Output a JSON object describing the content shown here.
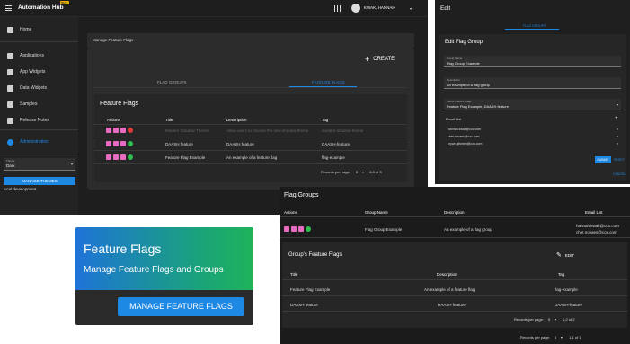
{
  "app": {
    "title": "Automation Hub",
    "beta_badge": "BETA",
    "user_name": "KWAK, HANNAH",
    "sidebar": [
      {
        "label": "Home",
        "icon": "home-icon"
      },
      {
        "label": "Applications",
        "icon": "apps-icon"
      },
      {
        "label": "App Widgets",
        "icon": "widgets-icon"
      },
      {
        "label": "Data Widgets",
        "icon": "data-icon"
      },
      {
        "label": "Samples",
        "icon": "samples-icon"
      },
      {
        "label": "Release Notes",
        "icon": "notes-icon"
      },
      {
        "label": "Administration",
        "icon": "admin-icon"
      }
    ],
    "theme_label": "Theme",
    "theme_value": "Dark",
    "manage_themes": "MANAGE THEMES",
    "env": "local development",
    "page_title": "Manage Feature Flags",
    "create_label": "CREATE",
    "tabs": [
      "FLAG GROUPS",
      "FEATURE FLAGS"
    ],
    "table_title": "Feature Flags",
    "columns": [
      "Actions",
      "Title",
      "Description",
      "Tag"
    ],
    "rows": [
      {
        "title": "Modern Shadow Theme",
        "desc": "Allow users to choose the new shadow theme",
        "tag": "modern-shadow-theme",
        "dim": true
      },
      {
        "title": "DAASH feature",
        "desc": "DAASH feature",
        "tag": "DAASH-feature",
        "dim": false
      },
      {
        "title": "Feature Flag Example",
        "desc": "An example of a feature flag",
        "tag": "flag-example",
        "dim": false
      }
    ],
    "rows_per_page": "Records per page:",
    "rpp_value": "5",
    "range": "1-3 of 3"
  },
  "edit": {
    "title": "Edit",
    "tab": "FLAG GROUPS",
    "heading": "Edit Flag Group",
    "group_name_label": "Group Name",
    "group_name": "Flag Group Example",
    "desc_label": "Description",
    "desc": "An example of a flag group",
    "select_label": "Select Feature Flags",
    "select_value": "Feature Flag Example, DAASH feature",
    "email_label": "Email List",
    "emails": [
      "hannah.kwak@cox.com",
      "chet.novaes@cox.com",
      "bryan.gilsmen@cox.com"
    ],
    "submit": "SUBMIT",
    "reset": "RESET",
    "cancel": "CANCEL"
  },
  "promo": {
    "title": "Feature Flags",
    "subtitle": "Manage Feature Flags and Groups",
    "button": "MANAGE FEATURE FLAGS"
  },
  "groups": {
    "title": "Flag Groups",
    "columns": [
      "Actions",
      "Group Name",
      "Description",
      "Email List"
    ],
    "row": {
      "name": "Flag Group Example",
      "desc": "An example of a flag group",
      "email1": "hannah.kwak@cox.com",
      "email2": "chet.novaes@cox.com"
    },
    "sub_title": "Group's Feature Flags",
    "edit": "EDIT",
    "sub_columns": [
      "Title",
      "Description",
      "Tag"
    ],
    "sub_rows": [
      {
        "title": "Feature Flag Example",
        "desc": "An example of a feature flag",
        "tag": "flag-example"
      },
      {
        "title": "DAASH feature",
        "desc": "DAASH feature",
        "tag": "DAASH-feature"
      }
    ],
    "sub_rpp": "Records per page:",
    "sub_rpp_value": "5",
    "sub_range": "1-2 of 2",
    "rpp": "Records per page:",
    "rpp_value": "5",
    "range": "1-1 of 1"
  },
  "colors": {
    "accent": "#1e88e5",
    "green": "#2ebd4e",
    "red": "#e53935",
    "pink": "#e96bc0"
  }
}
